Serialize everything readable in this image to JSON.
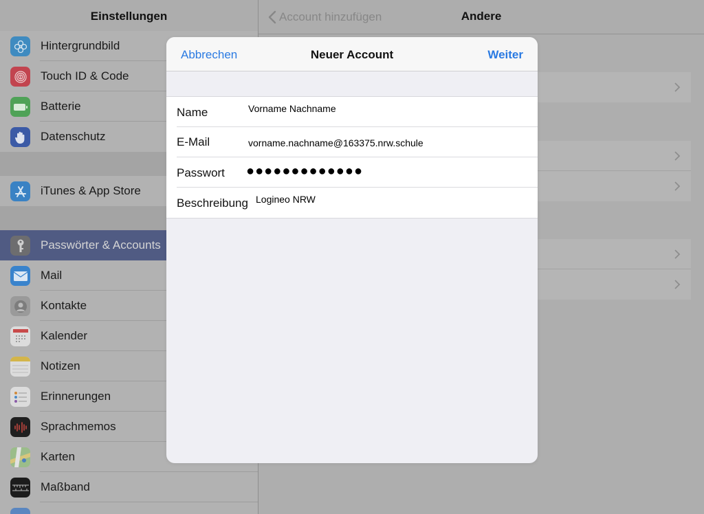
{
  "sidebar": {
    "title": "Einstellungen",
    "items": [
      {
        "label": "Hintergrundbild",
        "icon": "flower-icon"
      },
      {
        "label": "Touch ID & Code",
        "icon": "fingerprint-icon"
      },
      {
        "label": "Batterie",
        "icon": "battery-icon"
      },
      {
        "label": "Datenschutz",
        "icon": "hand-icon"
      },
      {
        "label": "iTunes & App Store",
        "icon": "app-store-icon"
      },
      {
        "label": "Passwörter & Accounts",
        "icon": "key-icon",
        "selected": true
      },
      {
        "label": "Mail",
        "icon": "mail-envelope-icon"
      },
      {
        "label": "Kontakte",
        "icon": "contacts-icon"
      },
      {
        "label": "Kalender",
        "icon": "calendar-icon"
      },
      {
        "label": "Notizen",
        "icon": "notes-icon"
      },
      {
        "label": "Erinnerungen",
        "icon": "reminders-icon"
      },
      {
        "label": "Sprachmemos",
        "icon": "voice-memo-icon"
      },
      {
        "label": "Karten",
        "icon": "maps-icon"
      },
      {
        "label": "Maßband",
        "icon": "measure-icon"
      }
    ]
  },
  "detail": {
    "back_label": "Account hinzufügen",
    "title": "Andere"
  },
  "modal": {
    "cancel_label": "Abbrechen",
    "title": "Neuer Account",
    "next_label": "Weiter",
    "fields": {
      "name": {
        "label": "Name",
        "value": "Vorname Nachname"
      },
      "email": {
        "label": "E-Mail",
        "value": "vorname.nachname@163375.nrw.schule"
      },
      "password": {
        "label": "Passwort",
        "value": "●●●●●●●●●●●●●"
      },
      "description": {
        "label": "Beschreibung",
        "value": "Logineo NRW"
      }
    }
  },
  "colors": {
    "accent": "#2a7ae2",
    "selected_row": "#505b83"
  }
}
